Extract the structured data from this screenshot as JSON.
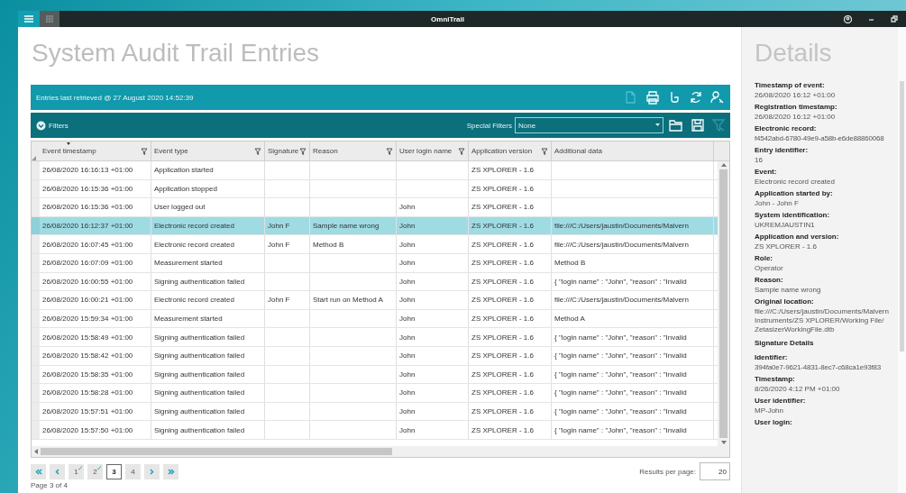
{
  "window": {
    "title": "OmniTrail"
  },
  "page_title": "System Audit Trail Entries",
  "retrieval_bar": {
    "text": "Entries last retrieved @ 27 August 2020 14:52:39",
    "tools": [
      {
        "disabled": true
      },
      {
        "disabled": false
      },
      {
        "disabled": false
      },
      {
        "disabled": false
      },
      {
        "disabled": false
      }
    ]
  },
  "filter_bar": {
    "label": "Filters",
    "special_filters_label": "Special Filters",
    "special_filter_value": "None",
    "clear_disabled": true
  },
  "table": {
    "columns": [
      {
        "label": "Event timestamp",
        "filter": true,
        "sorted": true
      },
      {
        "label": "Event type",
        "filter": true,
        "sorted": false
      },
      {
        "label": "Signature",
        "filter": true,
        "sorted": false
      },
      {
        "label": "Reason",
        "filter": true,
        "sorted": false
      },
      {
        "label": "User login name",
        "filter": true,
        "sorted": false
      },
      {
        "label": "Application version",
        "filter": true,
        "sorted": false
      },
      {
        "label": "Additional data",
        "filter": false,
        "sorted": false
      }
    ],
    "rows": [
      {
        "selected": false,
        "cells": [
          {
            "text": "26/08/2020 16:16:13 +01:00"
          },
          {
            "text": "Application started"
          },
          {},
          {},
          {},
          {
            "text": "ZS XPLORER - 1.6"
          },
          {}
        ]
      },
      {
        "selected": false,
        "cells": [
          {
            "text": "26/08/2020 16:15:36 +01:00"
          },
          {
            "text": "Application stopped"
          },
          {},
          {},
          {},
          {
            "text": "ZS XPLORER - 1.6"
          },
          {}
        ]
      },
      {
        "selected": false,
        "cells": [
          {
            "text": "26/08/2020 16:15:36 +01:00"
          },
          {
            "text": "User logged out"
          },
          {},
          {},
          {
            "text": "John"
          },
          {
            "text": "ZS XPLORER - 1.6"
          },
          {}
        ]
      },
      {
        "selected": true,
        "cells": [
          {
            "text": "26/08/2020 16:12:37 +01:00"
          },
          {
            "text": "Electronic record created"
          },
          {
            "text": "John F"
          },
          {
            "text": "Sample name wrong"
          },
          {
            "text": "John"
          },
          {
            "text": "ZS XPLORER - 1.6"
          },
          {
            "text": "file:///C:/Users/jaustin/Documents/Malvern"
          }
        ]
      },
      {
        "selected": false,
        "cells": [
          {
            "text": "26/08/2020 16:07:45 +01:00"
          },
          {
            "text": "Electronic record created"
          },
          {
            "text": "John F"
          },
          {
            "text": "Method B"
          },
          {
            "text": "John"
          },
          {
            "text": "ZS XPLORER - 1.6"
          },
          {
            "text": "file:///C:/Users/jaustin/Documents/Malvern"
          }
        ]
      },
      {
        "selected": false,
        "cells": [
          {
            "text": "26/08/2020 16:07:09 +01:00"
          },
          {
            "text": "Measurement started"
          },
          {},
          {},
          {
            "text": "John"
          },
          {
            "text": "ZS XPLORER - 1.6"
          },
          {
            "text": "Method B"
          }
        ]
      },
      {
        "selected": false,
        "cells": [
          {
            "text": "26/08/2020 16:00:55 +01:00"
          },
          {
            "text": "Signing authentication failed"
          },
          {},
          {},
          {
            "text": "John"
          },
          {
            "text": "ZS XPLORER - 1.6"
          },
          {
            "text": "{ \"login name\" : \"John\", \"reason\" : \"Invalid"
          }
        ]
      },
      {
        "selected": false,
        "cells": [
          {
            "text": "26/08/2020 16:00:21 +01:00"
          },
          {
            "text": "Electronic record created"
          },
          {
            "text": "John F"
          },
          {
            "text": "Start run on Method A"
          },
          {
            "text": "John"
          },
          {
            "text": "ZS XPLORER - 1.6"
          },
          {
            "text": "file:///C:/Users/jaustin/Documents/Malvern"
          }
        ]
      },
      {
        "selected": false,
        "cells": [
          {
            "text": "26/08/2020 15:59:34 +01:00"
          },
          {
            "text": "Measurement started"
          },
          {},
          {},
          {
            "text": "John"
          },
          {
            "text": "ZS XPLORER - 1.6"
          },
          {
            "text": "Method A"
          }
        ]
      },
      {
        "selected": false,
        "cells": [
          {
            "text": "26/08/2020 15:58:49 +01:00"
          },
          {
            "text": "Signing authentication failed"
          },
          {},
          {},
          {
            "text": "John"
          },
          {
            "text": "ZS XPLORER - 1.6"
          },
          {
            "text": "{ \"login name\" : \"John\", \"reason\" : \"Invalid"
          }
        ]
      },
      {
        "selected": false,
        "cells": [
          {
            "text": "26/08/2020 15:58:42 +01:00"
          },
          {
            "text": "Signing authentication failed"
          },
          {},
          {},
          {
            "text": "John"
          },
          {
            "text": "ZS XPLORER - 1.6"
          },
          {
            "text": "{ \"login name\" : \"John\", \"reason\" : \"Invalid"
          }
        ]
      },
      {
        "selected": false,
        "cells": [
          {
            "text": "26/08/2020 15:58:35 +01:00"
          },
          {
            "text": "Signing authentication failed"
          },
          {},
          {},
          {
            "text": "John"
          },
          {
            "text": "ZS XPLORER - 1.6"
          },
          {
            "text": "{ \"login name\" : \"John\", \"reason\" : \"Invalid"
          }
        ]
      },
      {
        "selected": false,
        "cells": [
          {
            "text": "26/08/2020 15:58:28 +01:00"
          },
          {
            "text": "Signing authentication failed"
          },
          {},
          {},
          {
            "text": "John"
          },
          {
            "text": "ZS XPLORER - 1.6"
          },
          {
            "text": "{ \"login name\" : \"John\", \"reason\" : \"Invalid"
          }
        ]
      },
      {
        "selected": false,
        "cells": [
          {
            "text": "26/08/2020 15:57:51 +01:00"
          },
          {
            "text": "Signing authentication failed"
          },
          {},
          {},
          {
            "text": "John"
          },
          {
            "text": "ZS XPLORER - 1.6"
          },
          {
            "text": "{ \"login name\" : \"John\", \"reason\" : \"Invalid"
          }
        ]
      },
      {
        "selected": false,
        "cells": [
          {
            "text": "26/08/2020 15:57:50 +01:00"
          },
          {
            "text": "Signing authentication failed"
          },
          {},
          {},
          {
            "text": "John"
          },
          {
            "text": "ZS XPLORER - 1.6"
          },
          {
            "text": "{ \"login name\" : \"John\", \"reason\" : \"Invalid"
          }
        ]
      }
    ]
  },
  "pagination": {
    "pages": [
      {
        "label": "1",
        "selected": false,
        "visited": true
      },
      {
        "label": "2",
        "selected": false,
        "visited": true
      },
      {
        "label": "3",
        "selected": true,
        "visited": false
      },
      {
        "label": "4",
        "selected": false,
        "visited": false
      }
    ],
    "page_info": "Page 3 of 4",
    "results_label": "Results per page:",
    "results_value": "20"
  },
  "details": {
    "title": "Details",
    "items": [
      {
        "kind": "field",
        "label": "Timestamp of event:",
        "value": "26/08/2020 16:12 +01:00"
      },
      {
        "kind": "field",
        "label": "Registration timestamp:",
        "value": "26/08/2020 16:12 +01:00"
      },
      {
        "kind": "field",
        "label": "Electronic record:",
        "value": "f4542abd-6780-49e9-a58b-e6de88860068"
      },
      {
        "kind": "field",
        "label": "Entry identifier:",
        "value": "16"
      },
      {
        "kind": "field",
        "label": "Event:",
        "value": "Electronic record created"
      },
      {
        "kind": "field",
        "label": "Application started by:",
        "value": "John - John F"
      },
      {
        "kind": "field",
        "label": "System identification:",
        "value": "UKREMJAUSTIN1"
      },
      {
        "kind": "field",
        "label": "Application and version:",
        "value": "ZS XPLORER - 1.6"
      },
      {
        "kind": "field",
        "label": "Role:",
        "value": "Operator"
      },
      {
        "kind": "field",
        "label": "Reason:",
        "value": "Sample name wrong"
      },
      {
        "kind": "field",
        "label": "Original location:",
        "value": "file:///C:/Users/jaustin/Documents/Malvern Instruments/ZS XPLORER/Working File/ ZetasizerWorkingFile.dtb"
      },
      {
        "kind": "heading",
        "label": "Signature Details"
      },
      {
        "kind": "field",
        "label": "Identifier:",
        "value": "394fa0e7-9621-4831-8ec7-c68ca1e93f83"
      },
      {
        "kind": "field",
        "label": "Timestamp:",
        "value": "8/26/2020 4:12 PM +01:00"
      },
      {
        "kind": "field",
        "label": "User identifier:",
        "value": "MP-John"
      },
      {
        "kind": "field",
        "label": "User login:"
      }
    ]
  }
}
